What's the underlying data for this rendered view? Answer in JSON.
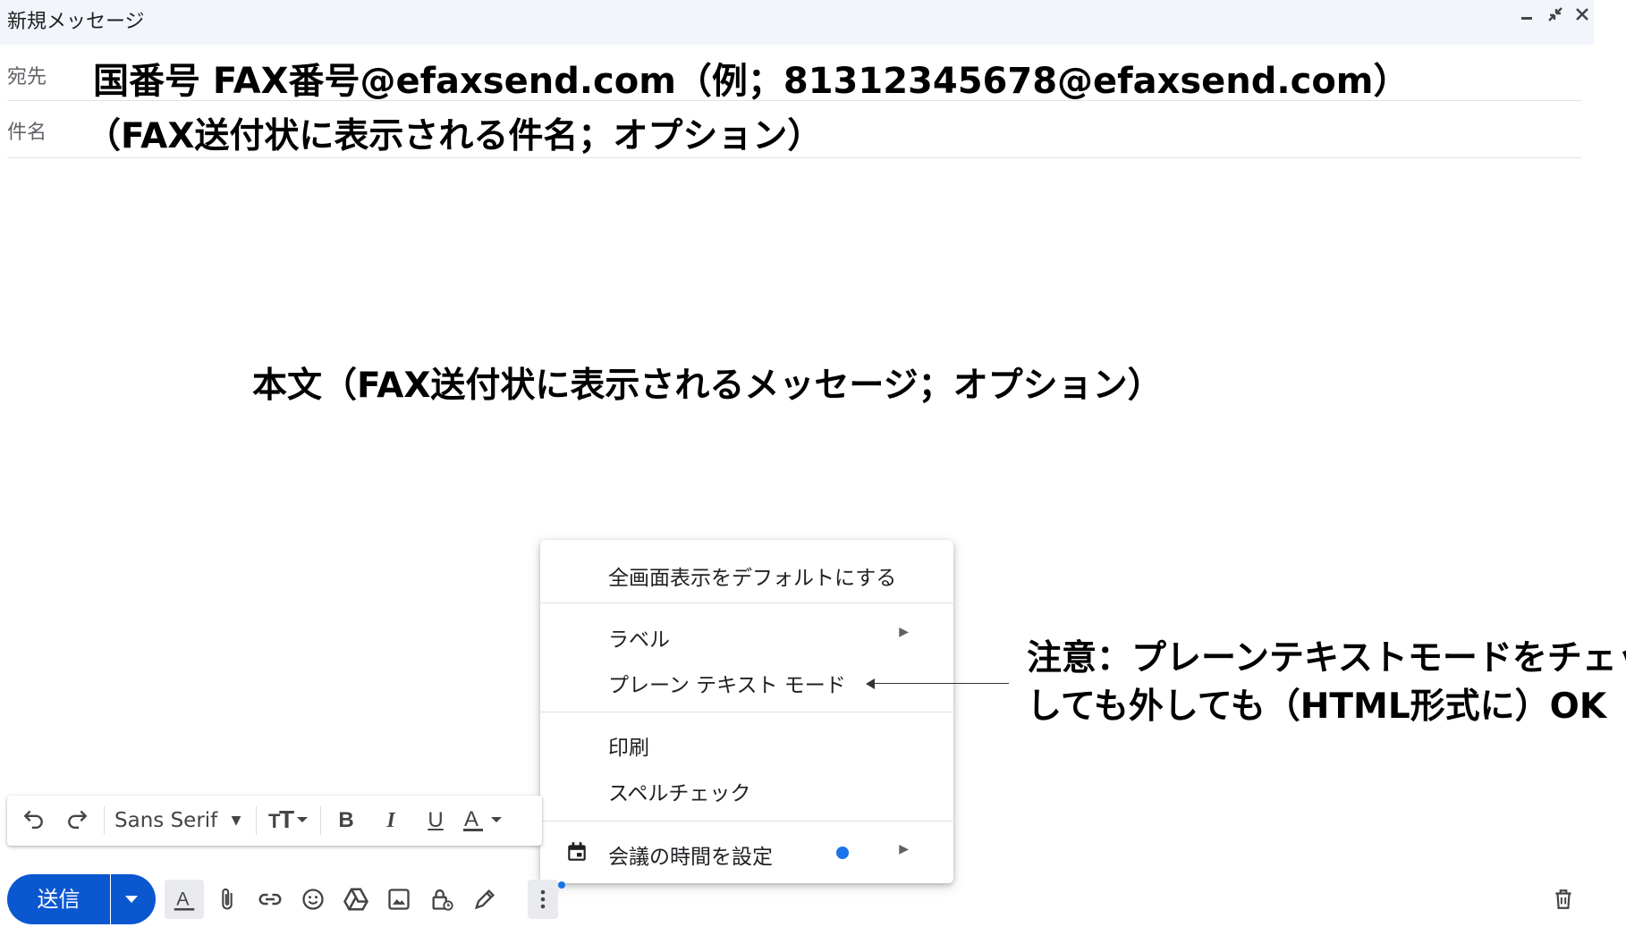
{
  "window": {
    "title": "新規メッセージ"
  },
  "fields": {
    "to_label": "宛先",
    "to_value": "国番号 FAX番号@efaxsend.com（例；81312345678@efaxsend.com）",
    "subject_label": "件名",
    "subject_value": "（FAX送付状に表示される件名；オプション）"
  },
  "body_note": "本文（FAX送付状に表示されるメッセージ；オプション）",
  "menu": {
    "items": [
      {
        "label": "全画面表示をデフォルトにする"
      },
      {
        "label": "ラベル"
      },
      {
        "label": "プレーン テキスト モード"
      },
      {
        "label": "印刷"
      },
      {
        "label": "スペルチェック"
      },
      {
        "label": "会議の時間を設定"
      }
    ]
  },
  "annotation": {
    "line1": "注意：プレーンテキストモードをチェック",
    "line2": "しても外しても（HTML形式に）OK"
  },
  "format_toolbar": {
    "font": "Sans Serif"
  },
  "bottom_bar": {
    "send_label": "送信"
  },
  "colors": {
    "accent": "#0b57d0",
    "dot": "#1a73e8",
    "titlebar_bg": "#f2f6fc"
  },
  "icons": [
    "undo-icon",
    "redo-icon",
    "text-size-icon",
    "bold-icon",
    "italic-icon",
    "underline-icon",
    "text-color-icon",
    "attach-icon",
    "link-icon",
    "emoji-icon",
    "drive-icon",
    "image-icon",
    "confidential-icon",
    "signature-icon",
    "more-icon",
    "trash-icon",
    "calendar-icon"
  ]
}
